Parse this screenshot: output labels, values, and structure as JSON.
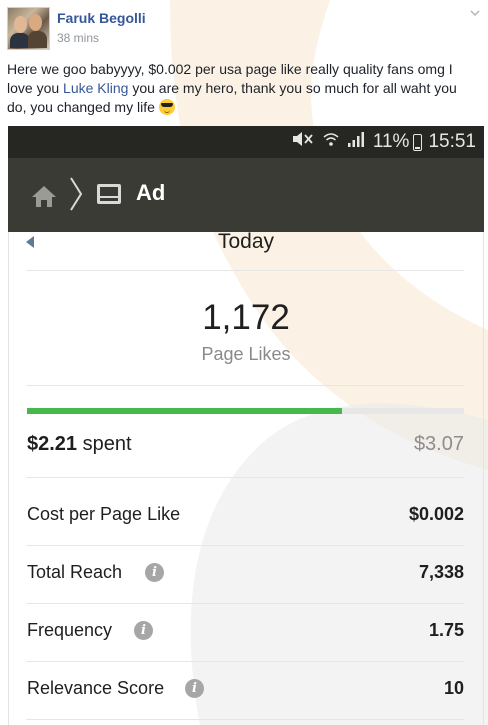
{
  "post": {
    "author": "Faruk Begolli",
    "time": "38 mins",
    "text_a": "Here we goo babyyyy, $0.002 per usa page like really quality fans omg I love you ",
    "mention": "Luke Kling",
    "text_b": " you are my hero, thank you so much for all waht you do, you changed my life "
  },
  "phone": {
    "status": {
      "battery": "11%",
      "time": "15:51"
    },
    "appbar": {
      "title": "Ad"
    },
    "date_label": "Today",
    "result": {
      "value": "1,172",
      "label": "Page Likes"
    },
    "budget": {
      "spent_amount": "$2.21",
      "spent_word": "spent",
      "total": "$3.07",
      "progress_fraction": 0.72
    },
    "metrics": [
      {
        "label": "Cost per Page Like",
        "value": "$0.002",
        "info": false
      },
      {
        "label": "Total Reach",
        "value": "7,338",
        "info": true
      },
      {
        "label": "Frequency",
        "value": "1.75",
        "info": true
      },
      {
        "label": "Relevance Score",
        "value": "10",
        "info": true
      }
    ]
  },
  "colors": {
    "accent": "#365899",
    "progress": "#47b84b",
    "appbar": "#3b3b35",
    "statusbar": "#262722"
  },
  "icons": [
    "home-icon",
    "chevron-right-icon",
    "ad-icon",
    "info-icon",
    "back-arrow-icon",
    "mute-icon",
    "wifi-icon",
    "signal-icon",
    "battery-icon",
    "sunglasses-emoji-icon"
  ]
}
